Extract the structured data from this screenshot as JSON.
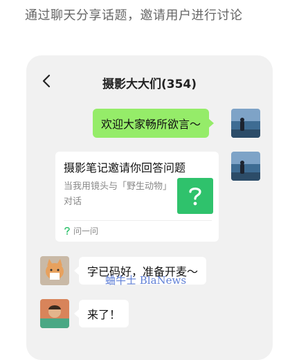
{
  "caption": "通过聊天分享话题，邀请用户进行讨论",
  "chat": {
    "title": "摄影大大们(354)",
    "back_label": "<"
  },
  "messages": {
    "welcome": "欢迎大家畅所欲言～",
    "share_card": {
      "title": "摄影笔记邀请你回答问题",
      "description": "当我用镜头与「野生动物」对话",
      "thumbnail_icon": "question-mark-icon",
      "footer_label": "问一问"
    },
    "reply_1": "字已码好，准备开麦～",
    "reply_2": "来了！"
  },
  "watermark": "蛐牛士 BlaNews",
  "colors": {
    "accent_green": "#2fc26c",
    "bubble_green": "#95ec69",
    "chat_background": "#f1f1f1"
  }
}
